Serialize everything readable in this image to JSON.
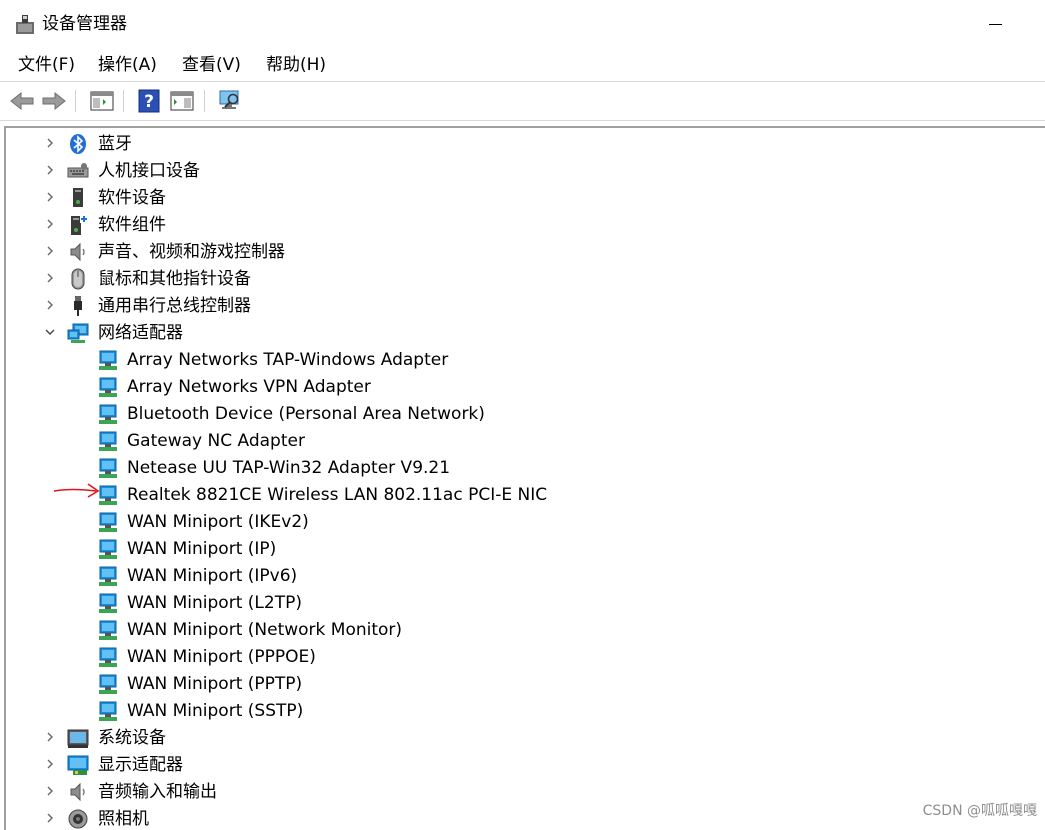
{
  "window": {
    "title": "设备管理器"
  },
  "menu": [
    {
      "label": "文件(F)"
    },
    {
      "label": "操作(A)"
    },
    {
      "label": "查看(V)"
    },
    {
      "label": "帮助(H)"
    }
  ],
  "toolbar": [
    {
      "icon": "back-arrow-icon"
    },
    {
      "icon": "forward-arrow-icon"
    },
    {
      "icon": "show-hide-console-tree-icon"
    },
    {
      "icon": "help-icon"
    },
    {
      "icon": "action-pane-icon"
    },
    {
      "icon": "scan-hardware-changes-icon"
    }
  ],
  "tree": {
    "categories_before": [
      {
        "label": "蓝牙",
        "icon": "bluetooth-icon"
      },
      {
        "label": "人机接口设备",
        "icon": "human-interface-device-icon"
      },
      {
        "label": "软件设备",
        "icon": "software-device-icon"
      },
      {
        "label": "软件组件",
        "icon": "software-component-icon"
      },
      {
        "label": "声音、视频和游戏控制器",
        "icon": "speaker-icon"
      },
      {
        "label": "鼠标和其他指针设备",
        "icon": "mouse-icon"
      },
      {
        "label": "通用串行总线控制器",
        "icon": "usb-icon"
      }
    ],
    "expanded": {
      "label": "网络适配器",
      "icon": "network-adapter-icon",
      "children": [
        {
          "label": "Array Networks TAP-Windows Adapter"
        },
        {
          "label": "Array Networks VPN Adapter"
        },
        {
          "label": "Bluetooth Device (Personal Area Network)"
        },
        {
          "label": "Gateway NC Adapter"
        },
        {
          "label": "Netease UU TAP-Win32 Adapter V9.21"
        },
        {
          "label": "Realtek 8821CE Wireless LAN 802.11ac PCI-E NIC"
        },
        {
          "label": "WAN Miniport (IKEv2)"
        },
        {
          "label": "WAN Miniport (IP)"
        },
        {
          "label": "WAN Miniport (IPv6)"
        },
        {
          "label": "WAN Miniport (L2TP)"
        },
        {
          "label": "WAN Miniport (Network Monitor)"
        },
        {
          "label": "WAN Miniport (PPPOE)"
        },
        {
          "label": "WAN Miniport (PPTP)"
        },
        {
          "label": "WAN Miniport (SSTP)"
        }
      ]
    },
    "categories_after": [
      {
        "label": "系统设备",
        "icon": "system-device-icon"
      },
      {
        "label": "显示适配器",
        "icon": "display-adapter-icon"
      },
      {
        "label": "音频输入和输出",
        "icon": "audio-io-icon"
      },
      {
        "label": "照相机",
        "icon": "camera-icon"
      }
    ]
  },
  "watermark": "CSDN @呱呱嘎嘎",
  "colors": {
    "annotation_arrow": "#e0141e",
    "network_icon": "#1a8fdb"
  }
}
